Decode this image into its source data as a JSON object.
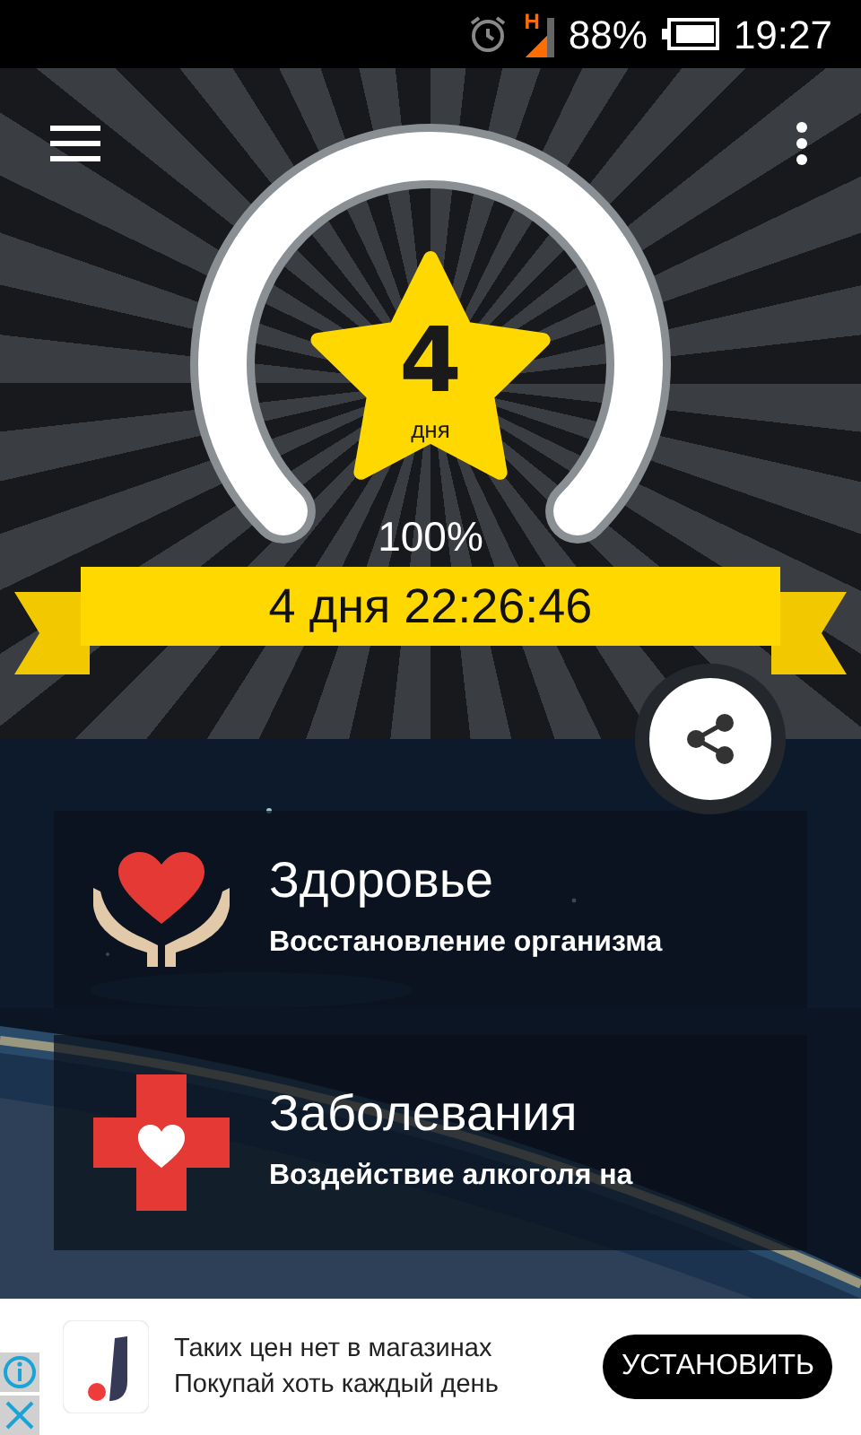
{
  "status_bar": {
    "network": "H",
    "battery": "88%",
    "time": "19:27"
  },
  "header": {
    "star_number": "4",
    "star_unit": "дня",
    "percent": "100%",
    "timer": "4 дня 22:26:46"
  },
  "cards": [
    {
      "kind": "health",
      "title": "Здоровье",
      "subtitle": "Восстановление организма"
    },
    {
      "kind": "disease",
      "title": "Заболевания",
      "subtitle": "Воздействие алкоголя на"
    }
  ],
  "ad": {
    "line_1": "Таких цен нет в магазинах",
    "line_2": "Покупай хоть каждый день",
    "button": "УСТАНОВИТЬ"
  }
}
